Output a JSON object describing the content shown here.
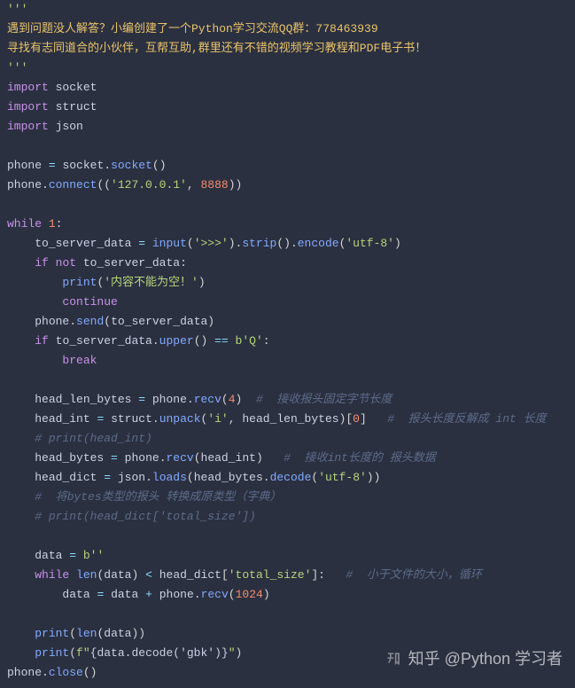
{
  "code": {
    "doc_open": "'''",
    "hl1": "遇到问题没人解答？小编创建了一个Python学习交流QQ群：778463939",
    "hl2": "寻找有志同道合的小伙伴，互帮互助,群里还有不错的视频学习教程和PDF电子书！",
    "doc_close": "'''",
    "imp_kw": "import",
    "mod_socket": "socket",
    "mod_struct": "struct",
    "mod_json": "json",
    "phone": "phone",
    "eq": "=",
    "dot": ".",
    "socket_call": "socket",
    "connect": "connect",
    "ip": "'127.0.0.1'",
    "port": "8888",
    "while_kw": "while",
    "one": "1",
    "colon": ":",
    "to_server_data": "to_server_data",
    "input": "input",
    "prompt": "'>>>'",
    "strip": "strip",
    "encode": "encode",
    "utf8": "'utf-8'",
    "if_kw": "if",
    "not_kw": "not",
    "print": "print",
    "empty_msg": "'内容不能为空！'",
    "continue_kw": "continue",
    "send": "send",
    "upper": "upper",
    "eqeq": "==",
    "bQ": "b'Q'",
    "break_kw": "break",
    "head_len_bytes": "head_len_bytes",
    "recv": "recv",
    "four": "4",
    "cmt1": "#  接收报头固定字节长度",
    "head_int": "head_int",
    "struct_mod": "struct",
    "unpack": "unpack",
    "fmt_i": "'i'",
    "idx0": "0",
    "cmt2": "#  报头长度反解成 int 长度",
    "cmt3": "# print(head_int)",
    "head_bytes": "head_bytes",
    "cmt4": "#  接收int长度的 报头数据",
    "head_dict": "head_dict",
    "json_mod": "json",
    "loads": "loads",
    "decode": "decode",
    "cmt5": "#  将bytes类型的报头 转换成原类型（字典）",
    "cmt6": "# print(head_dict['total_size'])",
    "data_var": "data",
    "bempty": "b''",
    "len": "len",
    "lt": "<",
    "total_size": "'total_size'",
    "cmt7": "#  小于文件的大小，循环",
    "plus": "+",
    "n1024": "1024",
    "fstr_open": "f\"",
    "fexpr": "{data.decode('gbk')}",
    "fstr_close": "\"",
    "close": "close"
  },
  "watermark": "知乎 @Python 学习者"
}
